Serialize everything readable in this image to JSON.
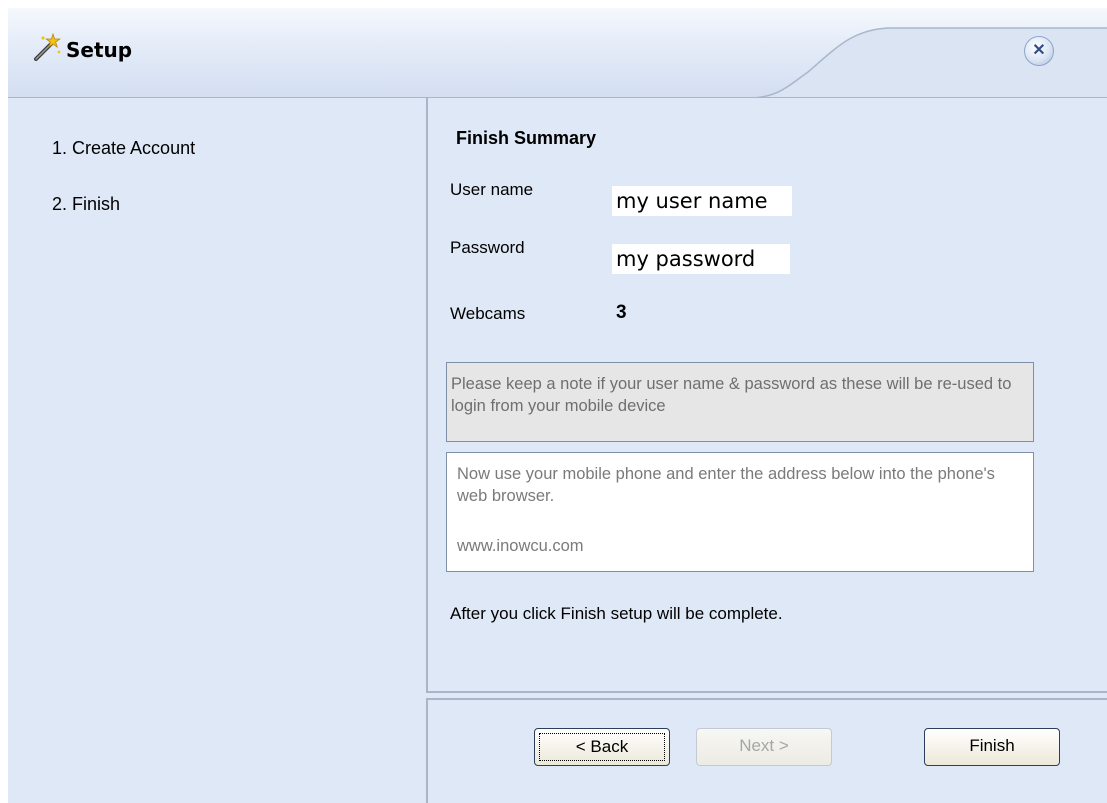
{
  "window": {
    "title": "Setup"
  },
  "sidebar": {
    "steps": [
      {
        "label": "1. Create Account"
      },
      {
        "label": "2. Finish"
      }
    ]
  },
  "summary": {
    "title": "Finish Summary",
    "user_name_label": "User name",
    "user_name_value": "my user name",
    "password_label": "Password",
    "password_value": "my password",
    "webcams_label": "Webcams",
    "webcams_value": "3",
    "note_text": "Please keep a note if your user name & password as these will be re-used to login from your mobile device",
    "info_text": "Now use your mobile phone and enter the address below into the phone's web browser.",
    "info_url": "www.inowcu.com",
    "after_text": "After you click Finish setup will be complete."
  },
  "buttons": {
    "back": "< Back",
    "next": "Next >",
    "finish": "Finish"
  },
  "icons": {
    "title": "setup-wand-icon",
    "close": "close-icon"
  }
}
